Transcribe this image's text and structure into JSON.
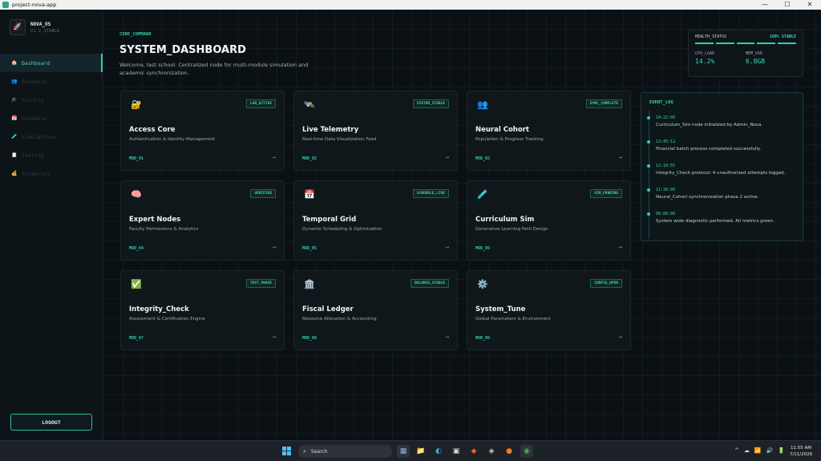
{
  "window": {
    "title": "project-nova-app",
    "controls": [
      "—",
      "☐",
      "✕"
    ]
  },
  "brand": {
    "name": "NOVA_OS",
    "version": "V1.2_STABLE"
  },
  "nav": {
    "items": [
      {
        "label": "Dashboard",
        "icon": "🏠",
        "active": true
      },
      {
        "label": "Students",
        "icon": "👥"
      },
      {
        "label": "Faculty",
        "icon": "🎓"
      },
      {
        "label": "Schedule",
        "icon": "📅"
      },
      {
        "label": "Simulations",
        "icon": "🧪"
      },
      {
        "label": "Testing",
        "icon": "📋"
      },
      {
        "label": "Financial",
        "icon": "💰"
      }
    ],
    "logout_label": "LOGOUT"
  },
  "header": {
    "breadcrumb": "CORE_COMMAND",
    "title": "SYSTEM_DASHBOARD",
    "subtitle": "Welcome, test school. Centralized node for multi-module simulation and academic synchronization."
  },
  "health": {
    "label": "HEALTH_STATUS",
    "value": "100% STABLE",
    "cpu_label": "CPU_LOAD",
    "cpu_value": "14.2%",
    "mem_label": "MEM_USE",
    "mem_value": "6.8GB"
  },
  "cards": [
    {
      "icon": "🔐",
      "badge": "LAB_ACTIVE",
      "title": "Access Core",
      "desc": "Authentication & Identity Management",
      "mod": "MOD_01",
      "arrow": "→"
    },
    {
      "icon": "🛰️",
      "badge": "SYSTEM_STABLE",
      "title": "Live Telemetry",
      "desc": "Real-time Data Visualization Feed",
      "mod": "MOD_02",
      "arrow": "→"
    },
    {
      "icon": "👥",
      "badge": "SYNC_COMPLETE",
      "title": "Neural Cohort",
      "desc": "Population & Progress Tracking",
      "mod": "MOD_03",
      "arrow": "→"
    },
    {
      "icon": "🧠",
      "badge": "VERIFIED",
      "title": "Expert Nodes",
      "desc": "Faculty Permissions & Analytics",
      "mod": "MOD_04",
      "arrow": "→"
    },
    {
      "icon": "📅",
      "badge": "SCHEDULE_LIVE",
      "title": "Temporal Grid",
      "desc": "Dynamic Scheduling & Optimization",
      "mod": "MOD_05",
      "arrow": "→"
    },
    {
      "icon": "🧪",
      "badge": "SIM_PENDING",
      "title": "Curriculum Sim",
      "desc": "Generative Learning Path Design",
      "mod": "MOD_06",
      "arrow": "→"
    },
    {
      "icon": "✅",
      "badge": "TEST_PHASE",
      "title": "Integrity_Check",
      "desc": "Assessment & Certification Engine",
      "mod": "MOD_07",
      "arrow": "→"
    },
    {
      "icon": "🏛️",
      "badge": "BALANCE_STABLE",
      "title": "Fiscal Ledger",
      "desc": "Resource Allocation & Accounting",
      "mod": "MOD_08",
      "arrow": "→"
    },
    {
      "icon": "⚙️",
      "badge": "CONFIG_OPEN",
      "title": "System_Tune",
      "desc": "Global Parameters & Environment",
      "mod": "MOD_09",
      "arrow": "→"
    }
  ],
  "event_log": {
    "title": "EVENT_LOG",
    "items": [
      {
        "time": "14:22:05",
        "msg": "Curriculum_Sim node initialized by Admin_Nova."
      },
      {
        "time": "13:45:12",
        "msg": "Financial batch process completed successfully."
      },
      {
        "time": "12:10:55",
        "msg": "Integrity_Check protocol: 4 unauthorized attempts logged."
      },
      {
        "time": "11:30:00",
        "msg": "Neural_Cohort synchronization phase 2 active."
      },
      {
        "time": "09:00:00",
        "msg": "System wide diagnostic performed. All metrics green."
      }
    ]
  },
  "taskbar": {
    "search_placeholder": "Search",
    "time": "11:55 AM",
    "date": "7/11/2026",
    "tray": [
      "^",
      "☁",
      "📶",
      "🔊",
      "🔋"
    ]
  },
  "colors": {
    "accent": "#2fd1a8",
    "bg": "#0a1014",
    "card": "#0f171b"
  }
}
